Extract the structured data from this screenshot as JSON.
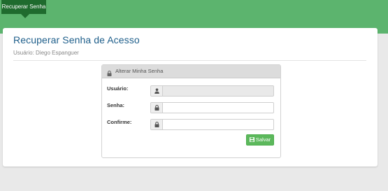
{
  "nav": {
    "active_tab": "Recuperar Senha"
  },
  "page": {
    "title": "Recuperar Senha de Acesso",
    "subtitle": "Usuário: Diego Espanguer"
  },
  "panel": {
    "title": "Alterar Minha Senha",
    "icon": "lock-icon"
  },
  "form": {
    "usuario": {
      "label": "Usuário:",
      "value": "",
      "icon": "user-icon",
      "disabled": true
    },
    "senha": {
      "label": "Senha:",
      "value": "",
      "icon": "lock-icon"
    },
    "confirme": {
      "label": "Confirme:",
      "value": "",
      "icon": "lock-icon"
    },
    "save_label": "Salvar",
    "save_icon": "floppy-disk-icon"
  },
  "colors": {
    "topbar": "#5cb46e",
    "active_tab": "#1f6b2e",
    "title": "#1f5f8b",
    "save_button": "#5cb85c"
  }
}
